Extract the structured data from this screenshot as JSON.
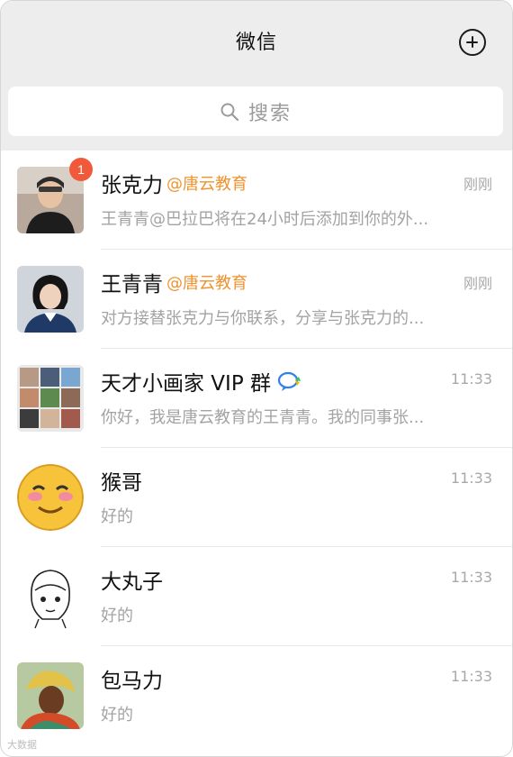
{
  "header": {
    "title": "微信",
    "add_icon": "plus-circle-icon"
  },
  "search": {
    "placeholder": "搜索",
    "icon": "search-icon"
  },
  "chats": [
    {
      "name": "张克力",
      "org": "@唐云教育",
      "time": "刚刚",
      "message": "王青青@巴拉巴将在24小时后添加到你的外...",
      "unread": "1",
      "avatar": "person-photo"
    },
    {
      "name": "王青青",
      "org": "@唐云教育",
      "time": "刚刚",
      "message": "对方接替张克力与你联系，分享与张克力的...",
      "avatar": "person-photo"
    },
    {
      "name": "天才小画家 VIP 群",
      "org": "",
      "time": "11:33",
      "message": "你好，我是唐云教育的王青青。我的同事张...",
      "group_icon": "enterprise-group-icon",
      "avatar": "group-grid"
    },
    {
      "name": "猴哥",
      "org": "",
      "time": "11:33",
      "message": "好的",
      "avatar": "smiley-emoji"
    },
    {
      "name": "大丸子",
      "org": "",
      "time": "11:33",
      "message": "好的",
      "avatar": "sketch-portrait"
    },
    {
      "name": "包马力",
      "org": "",
      "time": "11:33",
      "message": "好的",
      "avatar": "colorful-portrait"
    }
  ],
  "colors": {
    "org_accent": "#f0922e",
    "badge": "#f05a3b",
    "header_bg": "#ededed"
  },
  "watermark": "大数据"
}
